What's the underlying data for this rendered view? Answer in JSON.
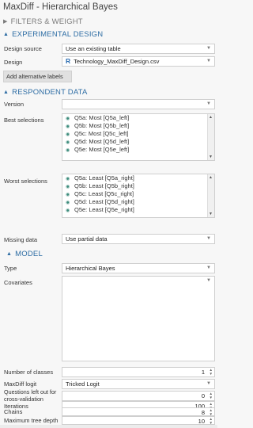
{
  "title": "MaxDiff - Hierarchical Bayes",
  "sections": {
    "filters": "FILTERS & WEIGHT",
    "experimental": "EXPERIMENTAL DESIGN",
    "respondent": "RESPONDENT DATA",
    "model": "MODEL"
  },
  "experimental": {
    "design_source_label": "Design source",
    "design_source_value": "Use an existing table",
    "design_label": "Design",
    "design_value": "Technology_MaxDiff_Design.csv",
    "design_logo": "R",
    "alt_labels_button": "Add alternative labels"
  },
  "respondent": {
    "version_label": "Version",
    "version_value": "",
    "best_label": "Best selections",
    "best_items": [
      "Q5a: Most [Q5a_left]",
      "Q5b: Most [Q5b_left]",
      "Q5c: Most [Q5c_left]",
      "Q5d: Most [Q5d_left]",
      "Q5e: Most [Q5e_left]"
    ],
    "worst_label": "Worst selections",
    "worst_items": [
      "Q5a: Least [Q5a_right]",
      "Q5b: Least [Q5b_right]",
      "Q5c: Least [Q5c_right]",
      "Q5d: Least [Q5d_right]",
      "Q5e: Least [Q5e_right]"
    ],
    "missing_label": "Missing data",
    "missing_value": "Use partial data"
  },
  "model": {
    "type_label": "Type",
    "type_value": "Hierarchical Bayes",
    "covariates_label": "Covariates",
    "classes_label": "Number of classes",
    "classes_value": "1",
    "logit_label": "MaxDiff logit",
    "logit_value": "Tricked Logit",
    "questions_label": "Questions left out for cross-validation",
    "questions_value": "0",
    "iterations_label": "Iterations",
    "iterations_value": "100",
    "chains_label": "Chains",
    "chains_value": "8",
    "tree_label": "Maximum tree depth",
    "tree_value": "10"
  },
  "icons": {
    "expand": "triangle-right-icon",
    "collapse": "triangle-down-icon",
    "dropdown": "chevron-down-icon",
    "variable": "variable-icon",
    "spinner": "spinner-icon"
  },
  "colors": {
    "section_blue": "#2e6da4",
    "section_gray": "#7a7a7a",
    "logo_blue": "#2b6cb0"
  }
}
